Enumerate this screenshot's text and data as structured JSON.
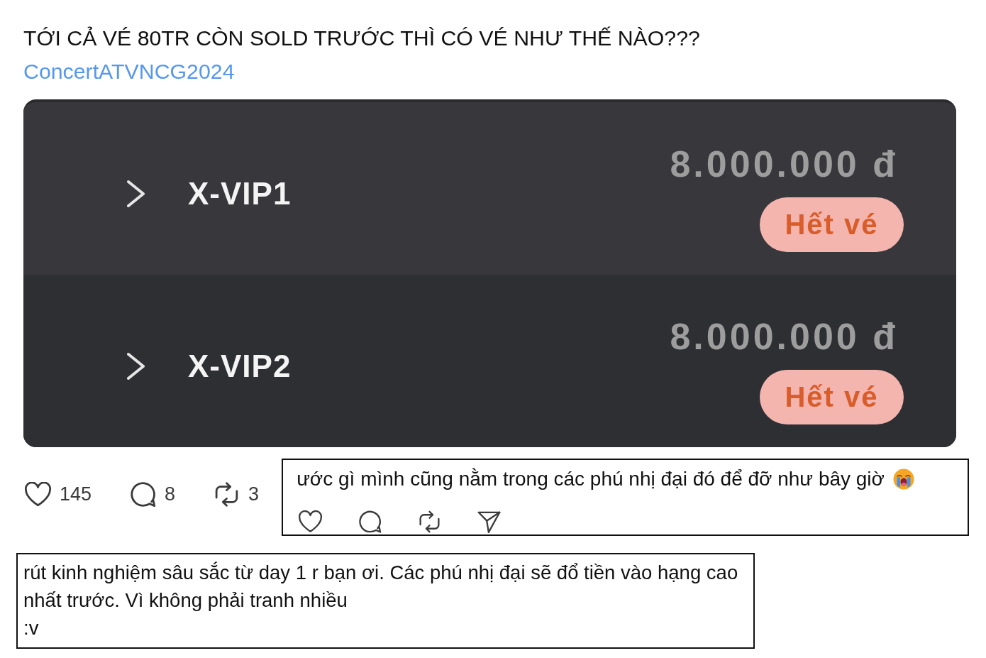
{
  "post": {
    "title": "TỚI CẢ VÉ 80TR CÒN SOLD TRƯỚC THÌ CÓ VÉ NHƯ THẾ NÀO???",
    "hashtag": "ConcertATVNCG2024"
  },
  "tickets": [
    {
      "name": "X-VIP1",
      "price": "8.000.000 đ",
      "status": "Hết vé"
    },
    {
      "name": "X-VIP2",
      "price": "8.000.000 đ",
      "status": "Hết vé"
    }
  ],
  "post_actions": [
    {
      "kind": "like",
      "count": "145"
    },
    {
      "kind": "comment",
      "count": "8"
    },
    {
      "kind": "repost",
      "count": "3"
    }
  ],
  "comments": [
    {
      "kind": "reply",
      "text": "ước gì mình cũng nằm trong các phú nhị đại đó để đỡ như bây giờ",
      "actions": [
        {
          "kind": "like"
        },
        {
          "kind": "comment"
        },
        {
          "kind": "repost"
        },
        {
          "kind": "share"
        }
      ]
    },
    {
      "kind": "note",
      "text": "rút kinh nghiệm sâu sắc từ day 1 r bạn ơi. Các phú nhị đại sẽ đổ tiền vào hạng cao\nnhất trước. Vì không phải tranh nhiều\n:v"
    }
  ]
}
